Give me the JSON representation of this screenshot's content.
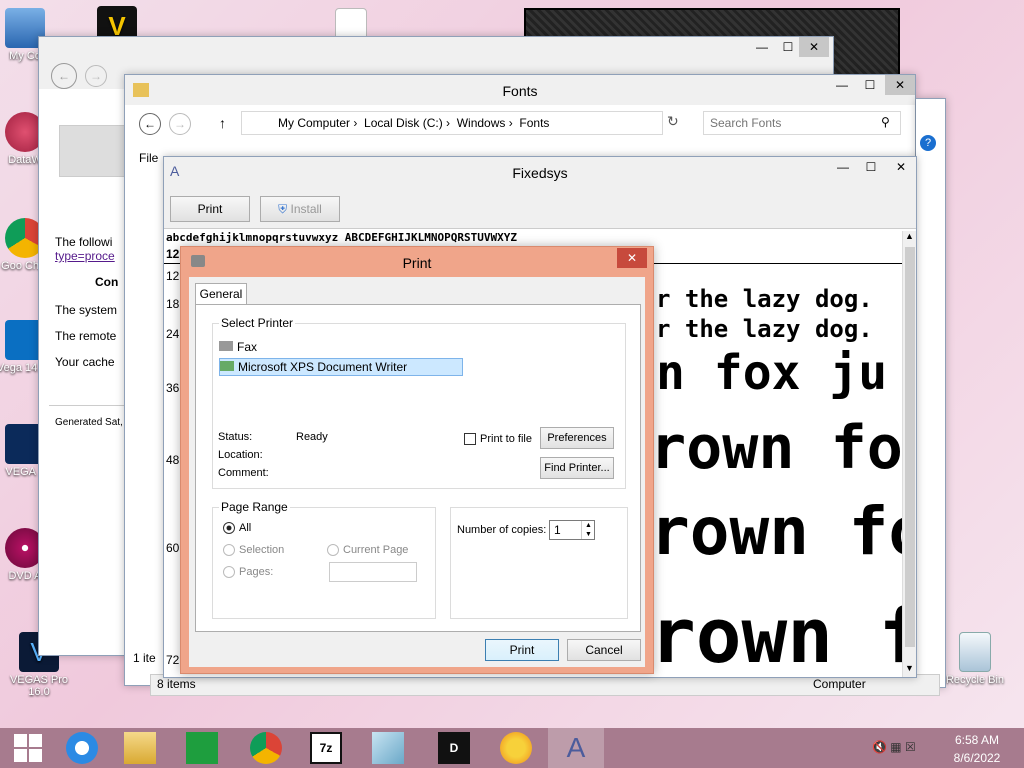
{
  "desktop": {
    "icons": [
      {
        "label": "My Co"
      },
      {
        "label": "DataW"
      },
      {
        "label": "Goo Chro"
      },
      {
        "label": "Vega 14.0 ("
      },
      {
        "label": "VEGA 1"
      },
      {
        "label": "DVD A"
      },
      {
        "label": "VEGAS Pro 16.0"
      },
      {
        "label": "Recycle Bin"
      }
    ]
  },
  "browser": {
    "content_lines": [
      "The followi",
      "type=proce",
      "Con",
      "The system",
      "The remote",
      "Your cache",
      "Generated Sat,"
    ]
  },
  "explorer": {
    "title": "Fonts",
    "breadcrumb": [
      "My Computer",
      "Local Disk (C:)",
      "Windows",
      "Fonts"
    ],
    "search_placeholder": "Search Fonts",
    "menu_first": "File",
    "status_left": "1 ite",
    "status_items": "8 items",
    "status_computer": "Computer"
  },
  "font_viewer": {
    "title": "Fixedsys",
    "print_label": "Print",
    "install_label": "Install",
    "charset_line": "abcdefghijklmnopqrstuvwxyz ABCDEFGHIJKLMNOPQRSTUVWXYZ",
    "sizes": [
      "12",
      "12",
      "18",
      "24",
      "36",
      "48",
      "60",
      "72"
    ],
    "samples": [
      "r the lazy dog.",
      "r the lazy dog.",
      "n fox ju",
      "rown fo",
      "rown fo",
      "rown fo"
    ]
  },
  "print_dialog": {
    "title": "Print",
    "tab_general": "General",
    "select_printer": "Select Printer",
    "printers": [
      "Fax",
      "Microsoft XPS Document Writer"
    ],
    "status_label": "Status:",
    "status_value": "Ready",
    "location_label": "Location:",
    "comment_label": "Comment:",
    "print_to_file": "Print to file",
    "preferences": "Preferences",
    "find_printer": "Find Printer...",
    "page_range": "Page Range",
    "all": "All",
    "selection": "Selection",
    "current_page": "Current Page",
    "pages": "Pages:",
    "copies_label": "Number of copies:",
    "copies_value": "1",
    "print_button": "Print",
    "cancel_button": "Cancel"
  },
  "taskbar": {
    "time": "6:58 AM",
    "date": "8/6/2022"
  }
}
